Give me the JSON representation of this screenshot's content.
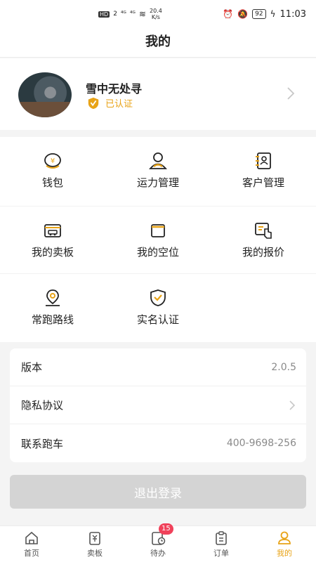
{
  "status_bar": {
    "network_badge": "HD",
    "sim": "2",
    "signal1": "⁴ᴳ",
    "signal2": "⁴ᴳ",
    "speed_value": "20.4",
    "speed_unit": "K/s",
    "battery": "92",
    "time": "11:03"
  },
  "header": {
    "title": "我的"
  },
  "profile": {
    "name": "雪中无处寻",
    "verified_label": "已认证"
  },
  "grid": {
    "items": [
      {
        "label": "钱包",
        "icon": "wallet-icon"
      },
      {
        "label": "运力管理",
        "icon": "driver-icon"
      },
      {
        "label": "客户管理",
        "icon": "contacts-icon"
      },
      {
        "label": "我的卖板",
        "icon": "truck-card-icon"
      },
      {
        "label": "我的空位",
        "icon": "wallet-slot-icon"
      },
      {
        "label": "我的报价",
        "icon": "quote-hand-icon"
      },
      {
        "label": "常跑路线",
        "icon": "location-pin-icon"
      },
      {
        "label": "实名认证",
        "icon": "shield-check-icon"
      }
    ]
  },
  "info": {
    "version_label": "版本",
    "version_value": "2.0.5",
    "privacy_label": "隐私协议",
    "contact_label": "联系跑车",
    "contact_value": "400-9698-256"
  },
  "logout_label": "退出登录",
  "tabbar": {
    "tabs": [
      {
        "label": "首页",
        "icon": "home-icon"
      },
      {
        "label": "卖板",
        "icon": "sell-icon"
      },
      {
        "label": "待办",
        "icon": "todo-icon",
        "badge": "15"
      },
      {
        "label": "订单",
        "icon": "order-icon"
      },
      {
        "label": "我的",
        "icon": "profile-icon"
      }
    ],
    "active": "我的"
  },
  "colors": {
    "accent": "#e8a317",
    "badge": "#f0415a",
    "logout_bg": "#d4d4d4"
  }
}
